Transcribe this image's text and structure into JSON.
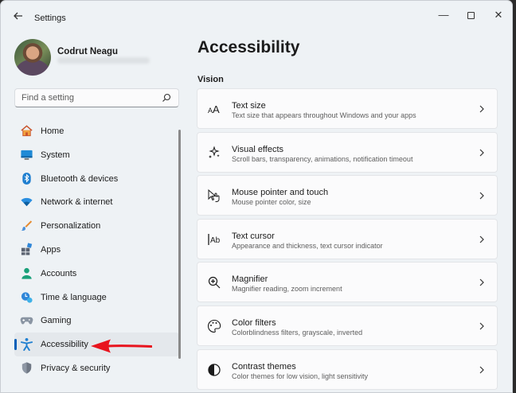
{
  "window": {
    "title": "Settings",
    "controls": {
      "minimize": "—",
      "close": "✕"
    }
  },
  "user": {
    "name": "Codrut Neagu"
  },
  "search": {
    "placeholder": "Find a setting"
  },
  "sidebar": {
    "items": [
      {
        "label": "Home",
        "icon": "home-icon"
      },
      {
        "label": "System",
        "icon": "system-icon"
      },
      {
        "label": "Bluetooth & devices",
        "icon": "bluetooth-icon"
      },
      {
        "label": "Network & internet",
        "icon": "wifi-icon"
      },
      {
        "label": "Personalization",
        "icon": "brush-icon"
      },
      {
        "label": "Apps",
        "icon": "apps-icon"
      },
      {
        "label": "Accounts",
        "icon": "accounts-icon"
      },
      {
        "label": "Time & language",
        "icon": "clock-globe-icon"
      },
      {
        "label": "Gaming",
        "icon": "gamepad-icon"
      },
      {
        "label": "Accessibility",
        "icon": "accessibility-icon",
        "selected": true
      },
      {
        "label": "Privacy & security",
        "icon": "shield-icon"
      }
    ]
  },
  "main": {
    "title": "Accessibility",
    "section": "Vision",
    "cards": [
      {
        "title": "Text size",
        "desc": "Text size that appears throughout Windows and your apps",
        "icon": "text-size-icon"
      },
      {
        "title": "Visual effects",
        "desc": "Scroll bars, transparency, animations, notification timeout",
        "icon": "sparkle-icon"
      },
      {
        "title": "Mouse pointer and touch",
        "desc": "Mouse pointer color, size",
        "icon": "pointer-icon"
      },
      {
        "title": "Text cursor",
        "desc": "Appearance and thickness, text cursor indicator",
        "icon": "text-cursor-icon"
      },
      {
        "title": "Magnifier",
        "desc": "Magnifier reading, zoom increment",
        "icon": "magnifier-icon"
      },
      {
        "title": "Color filters",
        "desc": "Colorblindness filters, grayscale, inverted",
        "icon": "palette-icon"
      },
      {
        "title": "Contrast themes",
        "desc": "Color themes for low vision, light sensitivity",
        "icon": "contrast-icon"
      }
    ]
  },
  "colors": {
    "accent": "#005fb8",
    "annotation_arrow": "#e8141e"
  }
}
